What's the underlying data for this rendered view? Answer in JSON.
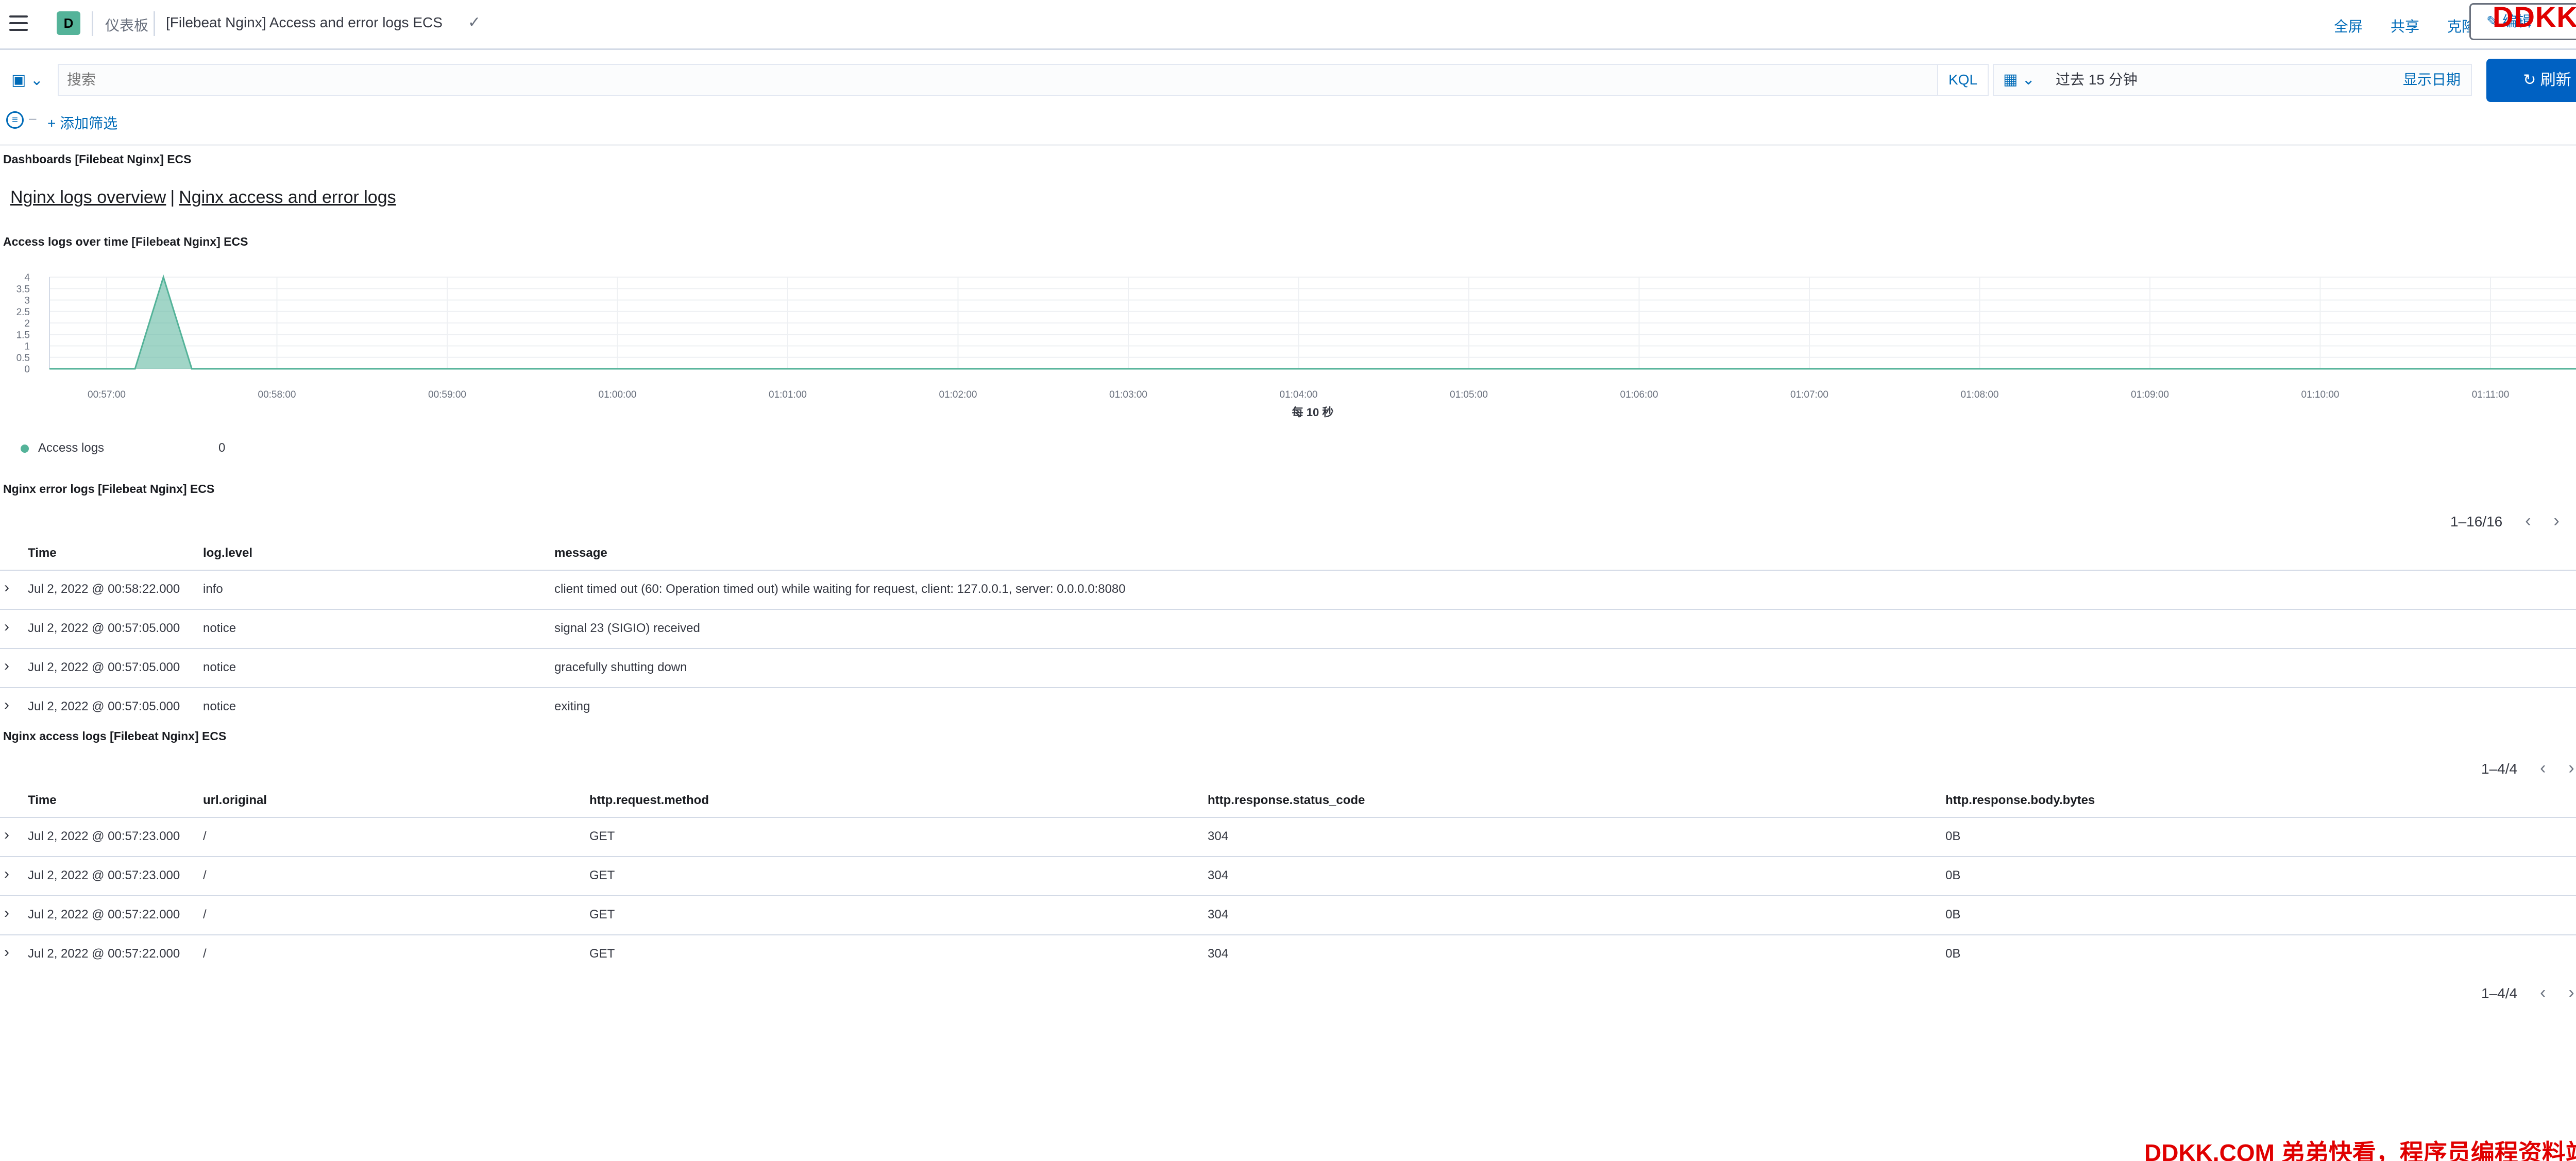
{
  "header": {
    "space_initial": "D",
    "breadcrumb_root": "仪表板",
    "breadcrumb_current": "[Filebeat Nginx] Access and error logs ECS",
    "fullscreen_label": "全屏",
    "share_label": "共享",
    "clone_label": "克隆",
    "edit_label": "编辑",
    "watermark": "DDKK.COM"
  },
  "query": {
    "search_placeholder": "搜索",
    "kql_label": "KQL",
    "time_range": "过去 15 分钟",
    "show_dates_label": "显示日期",
    "refresh_label": "刷新"
  },
  "filters": {
    "add_filter_label": "+ 添加筛选"
  },
  "panels": {
    "markdown": {
      "title": "Dashboards [Filebeat Nginx] ECS",
      "link1": "Nginx logs overview",
      "separator": "|",
      "link2": "Nginx access and error logs"
    },
    "chart": {
      "title": "Access logs over time [Filebeat Nginx] ECS",
      "legend_label": "Access logs",
      "legend_value": "0"
    },
    "error_logs": {
      "title": "Nginx error logs [Filebeat Nginx] ECS",
      "pager": "1–16/16",
      "columns": [
        "Time",
        "log.level",
        "message"
      ],
      "rows": [
        {
          "time": "Jul 2, 2022 @ 00:58:22.000",
          "level": "info",
          "message": "client timed out (60: Operation timed out) while waiting for request, client: 127.0.0.1, server: 0.0.0.0:8080"
        },
        {
          "time": "Jul 2, 2022 @ 00:57:05.000",
          "level": "notice",
          "message": "signal 23 (SIGIO) received"
        },
        {
          "time": "Jul 2, 2022 @ 00:57:05.000",
          "level": "notice",
          "message": "gracefully shutting down"
        },
        {
          "time": "Jul 2, 2022 @ 00:57:05.000",
          "level": "notice",
          "message": "exiting"
        }
      ]
    },
    "access_logs": {
      "title": "Nginx access logs [Filebeat Nginx] ECS",
      "pager_top": "1–4/4",
      "pager_bottom": "1–4/4",
      "columns": [
        "Time",
        "url.original",
        "http.request.method",
        "http.response.status_code",
        "http.response.body.bytes"
      ],
      "rows": [
        {
          "time": "Jul 2, 2022 @ 00:57:23.000",
          "url": "/",
          "method": "GET",
          "status": "304",
          "bytes": "0B"
        },
        {
          "time": "Jul 2, 2022 @ 00:57:23.000",
          "url": "/",
          "method": "GET",
          "status": "304",
          "bytes": "0B"
        },
        {
          "time": "Jul 2, 2022 @ 00:57:22.000",
          "url": "/",
          "method": "GET",
          "status": "304",
          "bytes": "0B"
        },
        {
          "time": "Jul 2, 2022 @ 00:57:22.000",
          "url": "/",
          "method": "GET",
          "status": "304",
          "bytes": "0B"
        }
      ]
    }
  },
  "footer_watermark": "DDKK.COM 弟弟快看，程序员编程资料站",
  "chart_data": {
    "type": "area",
    "title": "Access logs over time [Filebeat Nginx] ECS",
    "xlabel": "每 10 秒",
    "ylabel": "",
    "x_ticks": [
      "00:57:00",
      "00:58:00",
      "00:59:00",
      "01:00:00",
      "01:01:00",
      "01:02:00",
      "01:03:00",
      "01:04:00",
      "01:05:00",
      "01:06:00",
      "01:07:00",
      "01:08:00",
      "01:09:00",
      "01:10:00",
      "01:11:00"
    ],
    "y_ticks": [
      "0",
      "0.5",
      "1",
      "1.5",
      "2",
      "2.5",
      "3",
      "3.5",
      "4"
    ],
    "ylim": [
      0,
      4
    ],
    "grid": true,
    "legend": "bottom-left",
    "series_color": "#54b399",
    "series": [
      {
        "name": "Access logs",
        "x_seconds": [
          -40,
          -30,
          -20,
          -10,
          0,
          10,
          20,
          30,
          40,
          50,
          60,
          900
        ],
        "y": [
          0,
          0,
          0,
          0,
          0,
          0,
          4,
          0,
          0,
          0,
          0,
          0
        ]
      }
    ]
  }
}
